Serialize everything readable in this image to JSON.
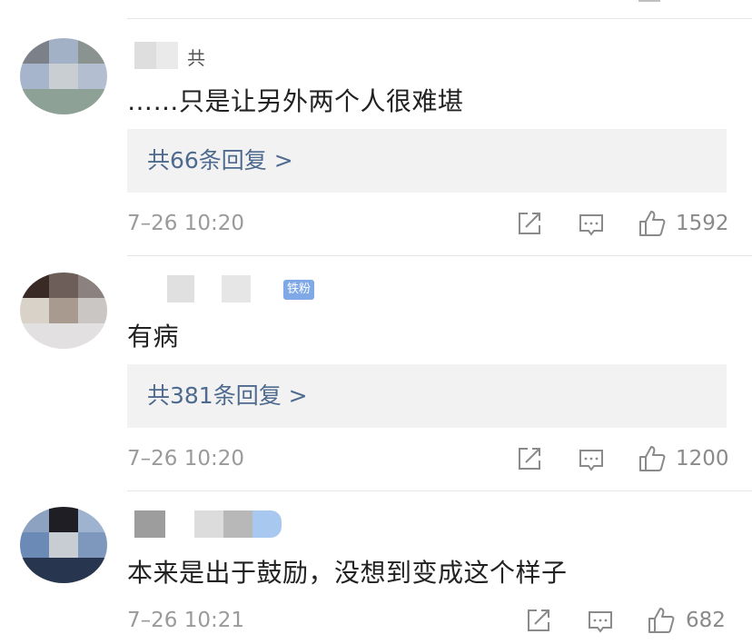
{
  "comments": [
    {
      "name_suffix": "共",
      "text": "……只是让另外两个人很难堪",
      "replies": "共66条回复 >",
      "time": "7–26 10:20",
      "likes": "1592"
    },
    {
      "name_suffix": "",
      "badge": "铁粉",
      "text": "有病",
      "replies": "共381条回复 >",
      "time": "7–26 10:20",
      "likes": "1200"
    },
    {
      "name_suffix": "",
      "text": "本来是出于鼓励，没想到变成这个样子",
      "time": "7–26 10:21",
      "likes": "682"
    }
  ],
  "icons": {
    "share": "share-icon",
    "reply": "comment-icon",
    "like": "thumbs-up-icon"
  },
  "colors": {
    "link": "#4e6a8f",
    "reply_bg": "#f2f2f2",
    "meta": "#9a9a9a",
    "badge": "#7fa8e6"
  }
}
